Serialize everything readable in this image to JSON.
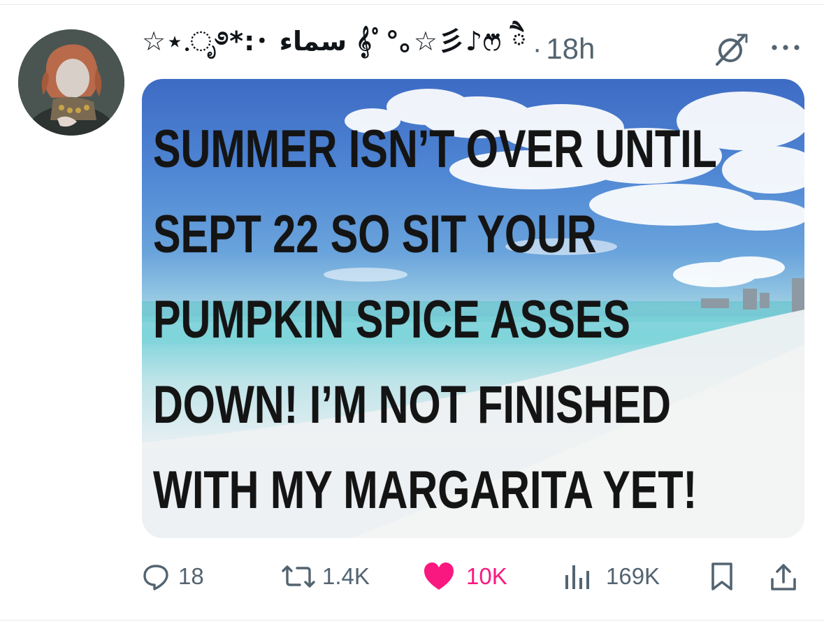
{
  "post": {
    "author": {
      "display_name": "☆⋆.ೃ࿔*:･ سماء 𝄞ﾟ°｡☆彡♪ෆ⃛ ཻ",
      "avatar_icon": "user-avatar"
    },
    "separator": "·",
    "timestamp": "18h",
    "media": {
      "meme_lines": [
        "SUMMER ISN’T OVER UNTIL",
        "SEPT 22 SO SIT YOUR",
        "PUMPKIN SPICE ASSES",
        "DOWN! I’M NOT FINISHED",
        "WITH MY MARGARITA YET!"
      ]
    },
    "actions": {
      "reply": {
        "icon": "reply-icon",
        "count": "18"
      },
      "repost": {
        "icon": "repost-icon",
        "count": "1.4K"
      },
      "like": {
        "icon": "heart-icon",
        "count": "10K",
        "liked": true,
        "color": "#f91880"
      },
      "views": {
        "icon": "views-icon",
        "count": "169K"
      },
      "bookmark": {
        "icon": "bookmark-icon"
      },
      "share": {
        "icon": "share-icon"
      }
    },
    "header_icons": {
      "grok": "grok-icon",
      "more": "more-icon"
    }
  },
  "colors": {
    "text_primary": "#0f1419",
    "text_secondary": "#536471",
    "like": "#f91880"
  }
}
